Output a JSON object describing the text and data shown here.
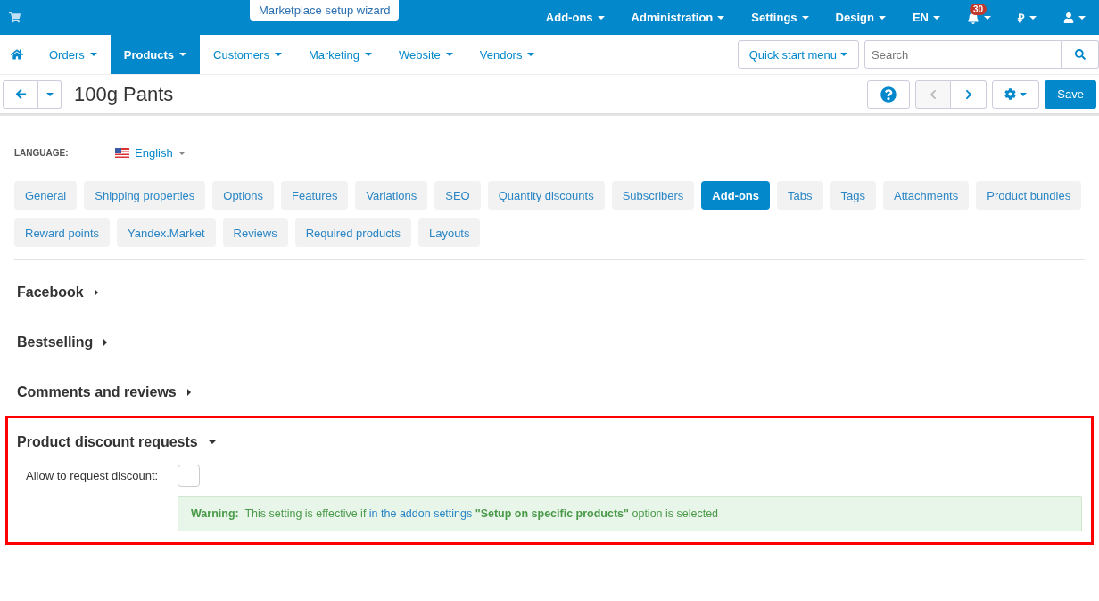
{
  "top_bar": {
    "wizard_button": "Marketplace setup wizard",
    "menus": [
      {
        "label": "Add-ons",
        "kind": "text"
      },
      {
        "label": "Administration",
        "kind": "text"
      },
      {
        "label": "Settings",
        "kind": "text"
      },
      {
        "label": "Design",
        "kind": "text"
      },
      {
        "label": "EN",
        "kind": "text"
      },
      {
        "kind": "bell",
        "badge": "30"
      },
      {
        "label": "₽",
        "kind": "text"
      },
      {
        "kind": "user"
      }
    ]
  },
  "nav": {
    "items": [
      {
        "label": "Orders",
        "selected": false
      },
      {
        "label": "Products",
        "selected": true
      },
      {
        "label": "Customers",
        "selected": false
      },
      {
        "label": "Marketing",
        "selected": false
      },
      {
        "label": "Website",
        "selected": false
      },
      {
        "label": "Vendors",
        "selected": false
      }
    ],
    "quick_start": "Quick start menu",
    "search": {
      "placeholder": "Search"
    }
  },
  "title_bar": {
    "title": "100g Pants",
    "save": "Save"
  },
  "language": {
    "label": "LANGUAGE:",
    "value": "English"
  },
  "tabs": [
    {
      "label": "General",
      "selected": false
    },
    {
      "label": "Shipping properties",
      "selected": false
    },
    {
      "label": "Options",
      "selected": false
    },
    {
      "label": "Features",
      "selected": false
    },
    {
      "label": "Variations",
      "selected": false
    },
    {
      "label": "SEO",
      "selected": false
    },
    {
      "label": "Quantity discounts",
      "selected": false
    },
    {
      "label": "Subscribers",
      "selected": false
    },
    {
      "label": "Add-ons",
      "selected": true
    },
    {
      "label": "Tabs",
      "selected": false
    },
    {
      "label": "Tags",
      "selected": false
    },
    {
      "label": "Attachments",
      "selected": false
    },
    {
      "label": "Product bundles",
      "selected": false
    },
    {
      "label": "Reward points",
      "selected": false
    },
    {
      "label": "Yandex.Market",
      "selected": false
    },
    {
      "label": "Reviews",
      "selected": false
    },
    {
      "label": "Required products",
      "selected": false
    },
    {
      "label": "Layouts",
      "selected": false
    }
  ],
  "sections": [
    {
      "title": "Facebook",
      "expanded": false,
      "highlighted": false
    },
    {
      "title": "Bestselling",
      "expanded": false,
      "highlighted": false
    },
    {
      "title": "Comments and reviews",
      "expanded": false,
      "highlighted": false
    },
    {
      "title": "Product discount requests",
      "expanded": true,
      "highlighted": true,
      "field": {
        "label": "Allow to request discount:",
        "checked": false
      },
      "warning": {
        "before": "**Warning:**  This setting is effective if ",
        "link": "in the addon settings",
        "after": " **\"Setup on specific products\"** option is selected"
      }
    }
  ]
}
